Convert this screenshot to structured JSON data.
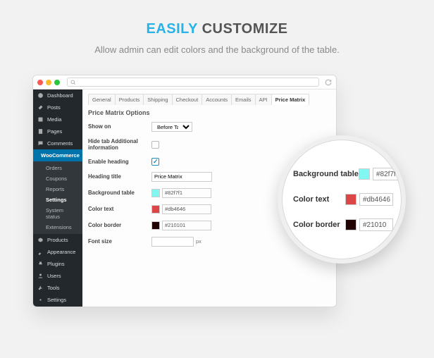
{
  "hero": {
    "title_accent": "EASILY",
    "title_rest": "CUSTOMIZE",
    "subtitle": "Allow admin can edit colors and the background of the table."
  },
  "sidebar": {
    "items": [
      {
        "icon": "dash",
        "label": "Dashboard"
      },
      {
        "icon": "pin",
        "label": "Posts"
      },
      {
        "icon": "media",
        "label": "Media"
      },
      {
        "icon": "page",
        "label": "Pages"
      },
      {
        "icon": "comment",
        "label": "Comments"
      },
      {
        "icon": "cart",
        "label": "WooCommerce"
      },
      {
        "icon": "box",
        "label": "Products"
      },
      {
        "icon": "brush",
        "label": "Appearance"
      },
      {
        "icon": "plug",
        "label": "Plugins"
      },
      {
        "icon": "user",
        "label": "Users"
      },
      {
        "icon": "wrench",
        "label": "Tools"
      },
      {
        "icon": "gear",
        "label": "Settings"
      }
    ],
    "subs": [
      "Orders",
      "Coupons",
      "Reports",
      "Settings",
      "System status",
      "Extensions"
    ]
  },
  "tabs": [
    "General",
    "Products",
    "Shipping",
    "Checkout",
    "Accounts",
    "Emails",
    "API",
    "Price Matrix"
  ],
  "section_title": "Price Matrix Options",
  "form": {
    "show_on": {
      "label": "Show on",
      "value": "Before Tab"
    },
    "hide_tab": {
      "label": "Hide tab Additional information"
    },
    "enable_heading": {
      "label": "Enable heading",
      "checked": true
    },
    "heading_title": {
      "label": "Heading title",
      "value": "Price Matrix"
    },
    "bg_table": {
      "label": "Background table",
      "color": "#82f7f1",
      "hex": "#82f7f1"
    },
    "color_text": {
      "label": "Color text",
      "color": "#db4646",
      "hex": "#db4646"
    },
    "color_border": {
      "label": "Color border",
      "color": "#210101",
      "hex": "#210101"
    },
    "font_size": {
      "label": "Font size",
      "unit": "px"
    }
  },
  "zoom": {
    "rows": [
      {
        "label": "Background table",
        "color": "#82f7f1",
        "hex": "#82f7f"
      },
      {
        "label": "Color text",
        "color": "#db4646",
        "hex": "#db4646"
      },
      {
        "label": "Color border",
        "color": "#210101",
        "hex": "#21010"
      }
    ]
  }
}
